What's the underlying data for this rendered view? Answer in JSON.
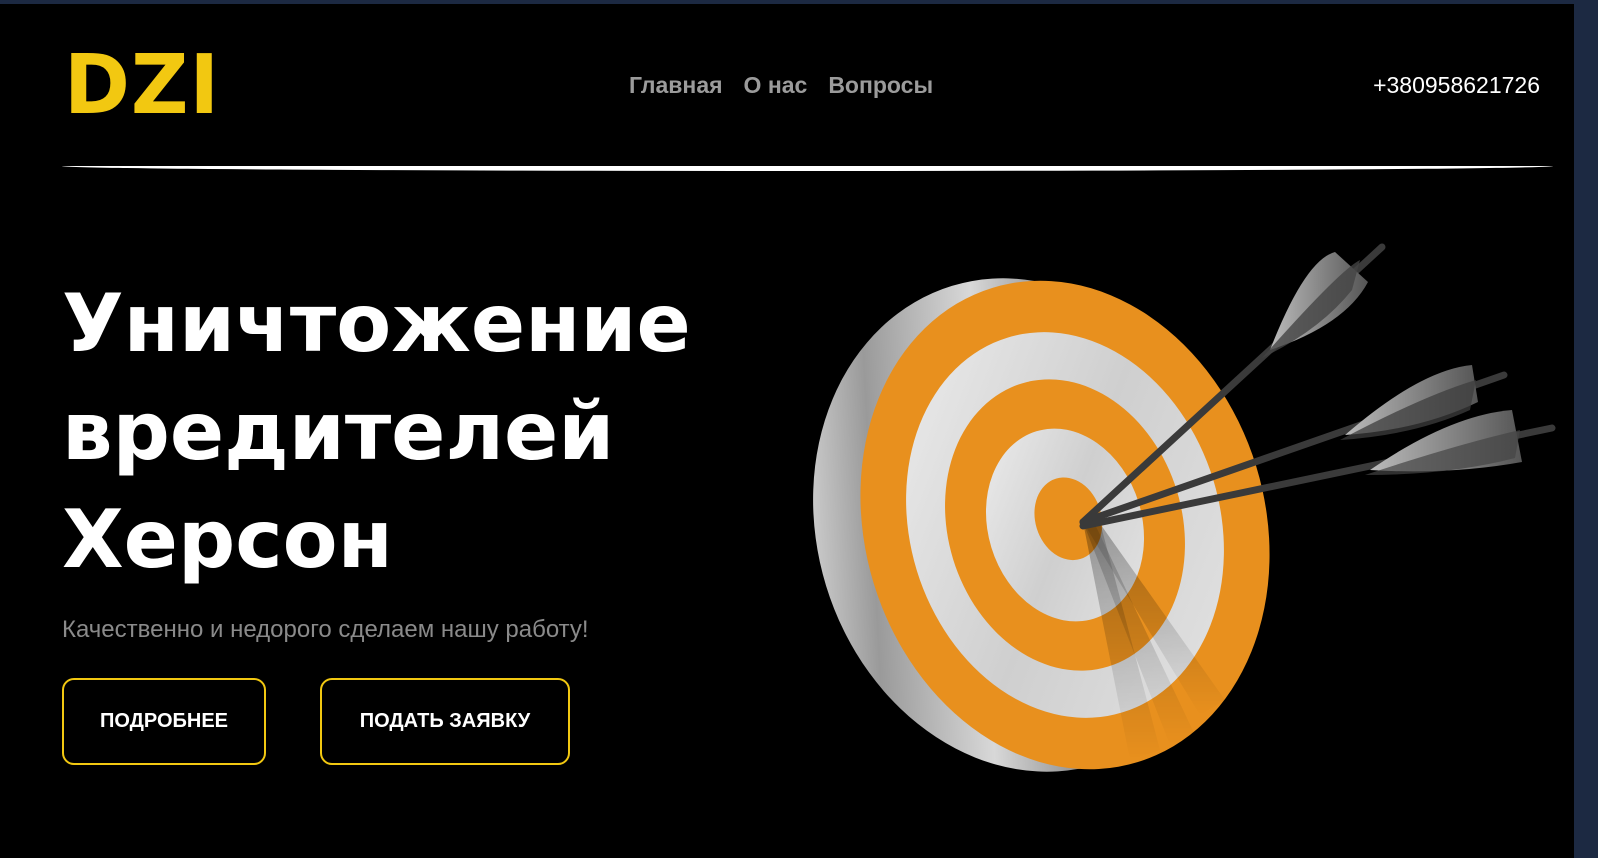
{
  "header": {
    "logo": "DZI",
    "nav": [
      "Главная",
      "О нас",
      "Вопросы"
    ],
    "phone": "+380958621726"
  },
  "hero": {
    "title_lines": [
      "Уничтожение",
      "вредителей",
      "Херсон"
    ],
    "subtitle": "Качественно и недорого сделаем нашу работу!",
    "buttons": {
      "more": "ПОДРОБНЕЕ",
      "apply": "ПОДАТЬ ЗАЯВКУ"
    }
  },
  "colors": {
    "background": "#000000",
    "accent": "#f2c811",
    "target_orange": "#e8901e",
    "target_white": "#dcdcdc"
  },
  "icons": {
    "hero_image": "target-with-arrows-icon"
  }
}
